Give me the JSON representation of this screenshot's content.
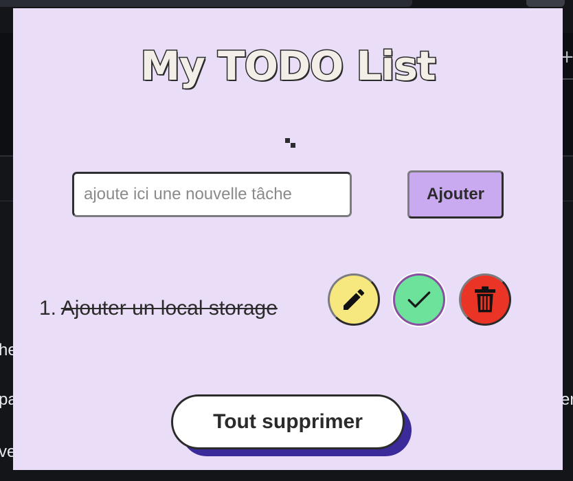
{
  "background": {
    "fragments": [
      "he",
      "pa",
      "ve",
      "er"
    ]
  },
  "app": {
    "title": "My TODO List",
    "input": {
      "placeholder": "ajoute ici une nouvelle tâche",
      "value": ""
    },
    "add_label": "Ajouter",
    "tasks": [
      {
        "number": "1.",
        "label": "Ajouter un local storage",
        "done": true
      }
    ],
    "clear_label": "Tout supprimer",
    "icons": {
      "edit": "pencil-icon",
      "done": "checkmark-icon",
      "delete": "trash-icon"
    },
    "colors": {
      "panel": "#e9ddf7",
      "accent": "#c9a9f0",
      "edit": "#f7e77f",
      "done": "#6de29a",
      "delete": "#ea3526",
      "shadow": "#3b2a9a"
    }
  }
}
